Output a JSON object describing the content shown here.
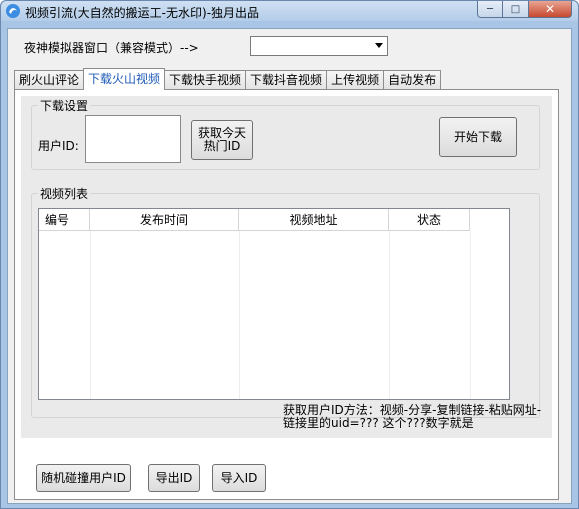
{
  "window": {
    "title": "视频引流(大自然的搬运工-无水印)-独月出品",
    "icons": [
      "app-icon",
      "minimize-icon",
      "maximize-icon",
      "close-icon"
    ]
  },
  "emulator": {
    "label": "夜神模拟器窗口（兼容模式）-->",
    "selected": ""
  },
  "tabs": [
    {
      "label": "刷火山评论"
    },
    {
      "label": "下载火山视频",
      "active": true
    },
    {
      "label": "下载快手视频"
    },
    {
      "label": "下载抖音视频"
    },
    {
      "label": "上传视频"
    },
    {
      "label": "自动发布"
    }
  ],
  "download_settings": {
    "group_title": "下载设置",
    "user_id_label": "用户ID:",
    "user_id_value": "",
    "get_today_hot_id": "获取今天热门ID",
    "start_download": "开始下载"
  },
  "video_list": {
    "group_title": "视频列表",
    "columns": [
      "编号",
      "发布时间",
      "视频地址",
      "状态"
    ],
    "rows": []
  },
  "bottom_buttons": {
    "random_collide": "随机碰撞用户ID",
    "export_id": "导出ID",
    "import_id": "导入ID"
  },
  "hint": "获取用户ID方法：视频-分享-复制链接-粘贴网址-链接里的uid=???  这个???数字就是"
}
